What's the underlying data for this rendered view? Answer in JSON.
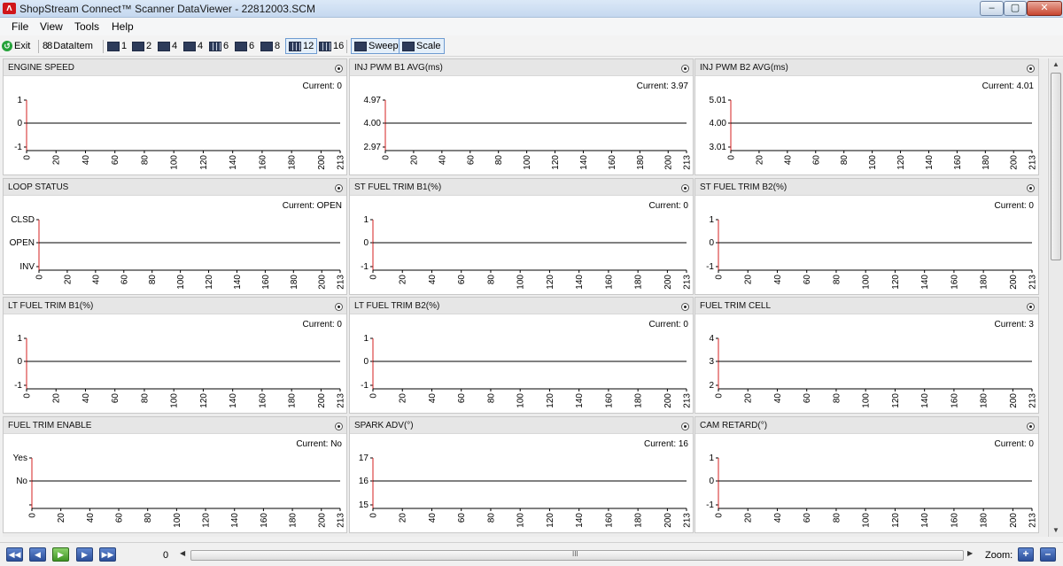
{
  "window": {
    "title": "ShopStream Connect™ Scanner DataViewer - 22812003.SCM",
    "icon_text": "ᐱ",
    "minimize": "–",
    "maximize": "▢",
    "close": "✕"
  },
  "menu": [
    "File",
    "View",
    "Tools",
    "Help"
  ],
  "toolbar": {
    "exit": "Exit",
    "dataitem_icon": "88",
    "dataitem": "DataItem",
    "layouts": [
      "1",
      "2",
      "4",
      "4",
      "6",
      "6",
      "8",
      "12",
      "16"
    ],
    "sweep": "Sweep",
    "scale": "Scale"
  },
  "panels": [
    {
      "title": "ENGINE SPEED",
      "current": "Current: 0",
      "yticks": [
        "1",
        "0",
        "-1"
      ]
    },
    {
      "title": "INJ PWM B1 AVG(ms)",
      "current": "Current: 3.97",
      "yticks": [
        "4.97",
        "4.00",
        "2.97"
      ]
    },
    {
      "title": "INJ PWM B2 AVG(ms)",
      "current": "Current: 4.01",
      "yticks": [
        "5.01",
        "4.00",
        "3.01"
      ]
    },
    {
      "title": "LOOP STATUS",
      "current": "Current: OPEN",
      "yticks": [
        "CLSD",
        "OPEN",
        "INV"
      ]
    },
    {
      "title": "ST FUEL TRIM B1(%)",
      "current": "Current: 0",
      "yticks": [
        "1",
        "0",
        "-1"
      ]
    },
    {
      "title": "ST FUEL TRIM B2(%)",
      "current": "Current: 0",
      "yticks": [
        "1",
        "0",
        "-1"
      ]
    },
    {
      "title": "LT FUEL TRIM B1(%)",
      "current": "Current: 0",
      "yticks": [
        "1",
        "0",
        "-1"
      ]
    },
    {
      "title": "LT FUEL TRIM B2(%)",
      "current": "Current: 0",
      "yticks": [
        "1",
        "0",
        "-1"
      ]
    },
    {
      "title": "FUEL TRIM CELL",
      "current": "Current: 3",
      "yticks": [
        "4",
        "3",
        "2"
      ]
    },
    {
      "title": "FUEL TRIM ENABLE",
      "current": "Current: No",
      "yticks": [
        "Yes",
        "No",
        ""
      ]
    },
    {
      "title": "SPARK ADV(°)",
      "current": "Current: 16",
      "yticks": [
        "17",
        "16",
        "15"
      ]
    },
    {
      "title": "CAM RETARD(°)",
      "current": "Current: 0",
      "yticks": [
        "1",
        "0",
        "-1"
      ]
    }
  ],
  "x_ticks": [
    "0",
    "20",
    "40",
    "60",
    "80",
    "100",
    "120",
    "140",
    "160",
    "180",
    "200",
    "213"
  ],
  "x_range": [
    0,
    213
  ],
  "bottom": {
    "nav": [
      "◀◀",
      "◀",
      "▶",
      "▶",
      "▶▶"
    ],
    "position": "0",
    "grip": "III",
    "zoom_label": "Zoom:",
    "zoom_in": "+",
    "zoom_out": "–"
  },
  "colors": {
    "trace_start": "#d42020",
    "axis": "#000000"
  }
}
